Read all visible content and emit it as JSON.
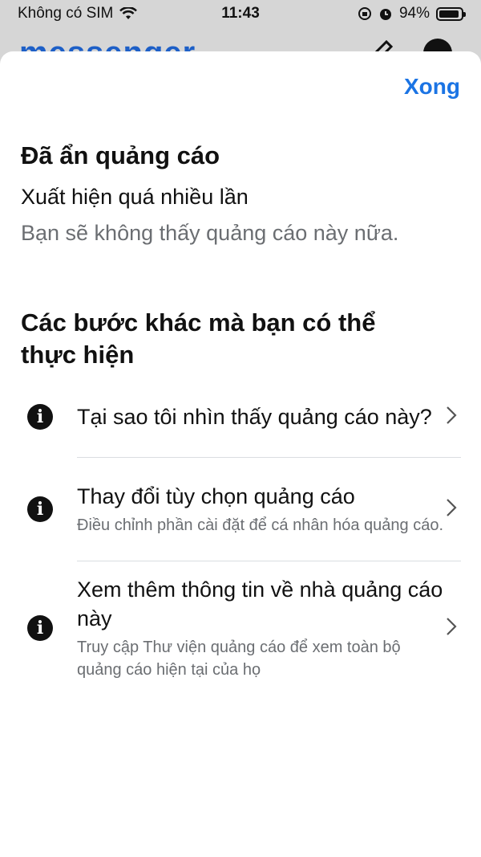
{
  "status_bar": {
    "carrier": "Không có SIM",
    "time": "11:43",
    "battery": "94%",
    "battery_level": 0.94
  },
  "background_app": {
    "logo": "messenger"
  },
  "sheet": {
    "done_label": "Xong",
    "hidden_title": "Đã ẩn quảng cáo",
    "hidden_reason": "Xuất hiện quá nhiều lần",
    "hidden_note": "Bạn sẽ không thấy quảng cáo này nữa.",
    "steps_title": "Các bước khác mà bạn có thể thực hiện",
    "options": [
      {
        "icon": "info-icon",
        "title": "Tại sao tôi nhìn thấy quảng cáo này?",
        "subtitle": ""
      },
      {
        "icon": "info-icon",
        "title": "Thay đổi tùy chọn quảng cáo",
        "subtitle": "Điều chỉnh phần cài đặt để cá nhân hóa quảng cáo."
      },
      {
        "icon": "info-icon",
        "title": "Xem thêm thông tin về nhà quảng cáo này",
        "subtitle": "Truy cập Thư viện quảng cáo để xem toàn bộ quảng cáo hiện tại của họ"
      }
    ]
  },
  "colors": {
    "accent": "#1b74e4",
    "secondary_text": "#6b6e72",
    "logo": "#1d5fc7"
  }
}
